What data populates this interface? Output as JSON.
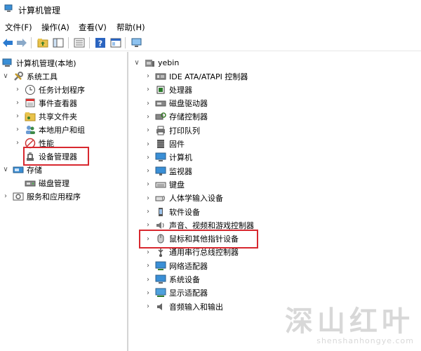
{
  "window": {
    "title": "计算机管理"
  },
  "menu": {
    "items": [
      "文件(F)",
      "操作(A)",
      "查看(V)",
      "帮助(H)"
    ]
  },
  "left_tree": {
    "root": "计算机管理(本地)",
    "system_tools": "系统工具",
    "task_scheduler": "任务计划程序",
    "event_viewer": "事件查看器",
    "shared_folders": "共享文件夹",
    "local_users": "本地用户和组",
    "performance": "性能",
    "device_manager": "设备管理器",
    "storage": "存储",
    "disk_management": "磁盘管理",
    "services_apps": "服务和应用程序"
  },
  "right_tree": {
    "computer_name": "yebin",
    "categories": [
      {
        "label": "IDE ATA/ATAPI 控制器",
        "icon": "ide-controller-icon"
      },
      {
        "label": "处理器",
        "icon": "processor-icon"
      },
      {
        "label": "磁盘驱动器",
        "icon": "disk-drive-icon"
      },
      {
        "label": "存储控制器",
        "icon": "storage-controller-icon"
      },
      {
        "label": "打印队列",
        "icon": "printer-icon"
      },
      {
        "label": "固件",
        "icon": "firmware-icon"
      },
      {
        "label": "计算机",
        "icon": "computer-icon"
      },
      {
        "label": "监视器",
        "icon": "monitor-icon"
      },
      {
        "label": "键盘",
        "icon": "keyboard-icon"
      },
      {
        "label": "人体学输入设备",
        "icon": "hid-icon"
      },
      {
        "label": "软件设备",
        "icon": "software-device-icon"
      },
      {
        "label": "声音、视频和游戏控制器",
        "icon": "sound-icon"
      },
      {
        "label": "鼠标和其他指针设备",
        "icon": "mouse-icon"
      },
      {
        "label": "通用串行总线控制器",
        "icon": "usb-icon"
      },
      {
        "label": "网络适配器",
        "icon": "network-adapter-icon"
      },
      {
        "label": "系统设备",
        "icon": "system-device-icon"
      },
      {
        "label": "显示适配器",
        "icon": "display-adapter-icon"
      },
      {
        "label": "音频输入和输出",
        "icon": "audio-io-icon"
      }
    ]
  },
  "watermark": {
    "cn": "深山红叶",
    "en": "shenshanhongye.com"
  },
  "colors": {
    "highlight": "#d8282f",
    "accent_blue": "#1f6fc5"
  }
}
